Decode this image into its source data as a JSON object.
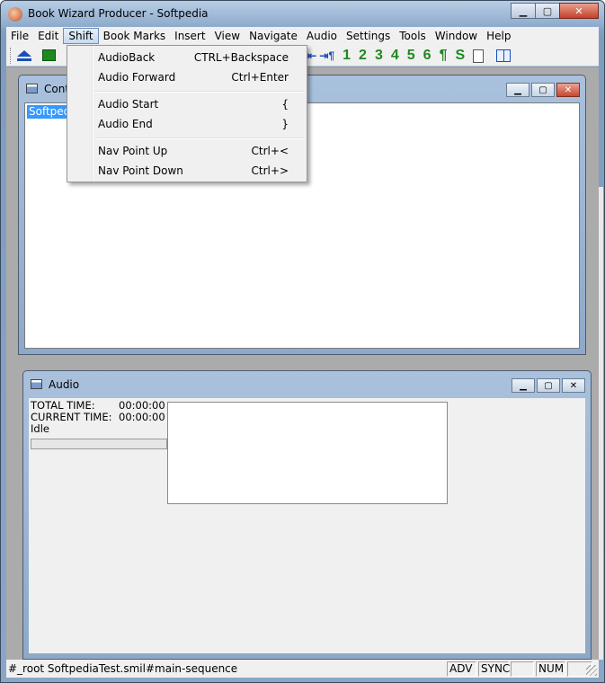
{
  "window": {
    "title": "Book Wizard Producer - Softpedia"
  },
  "menubar": {
    "items": [
      "File",
      "Edit",
      "Shift",
      "Book Marks",
      "Insert",
      "View",
      "Navigate",
      "Audio",
      "Settings",
      "Tools",
      "Window",
      "Help"
    ],
    "active": "Shift"
  },
  "toolbar": {
    "nav_glyph": "⇤ ⇥¶",
    "levels": [
      "1",
      "2",
      "3",
      "4",
      "5",
      "6"
    ],
    "para_glyph": "¶",
    "s_glyph": "S"
  },
  "shift_menu": {
    "groups": [
      [
        {
          "label": "AudioBack",
          "shortcut": "CTRL+Backspace"
        },
        {
          "label": "Audio Forward",
          "shortcut": "Ctrl+Enter"
        }
      ],
      [
        {
          "label": "Audio Start",
          "shortcut": "{"
        },
        {
          "label": "Audio End",
          "shortcut": "}"
        }
      ],
      [
        {
          "label": "Nav Point Up",
          "shortcut": "Ctrl+<"
        },
        {
          "label": "Nav Point Down",
          "shortcut": "Ctrl+>"
        }
      ]
    ]
  },
  "contents_window": {
    "title": "Cont",
    "selected_item": "Softpedia"
  },
  "audio_window": {
    "title": "Audio",
    "total_time_label": "TOTAL TIME:",
    "total_time_value": "00:00:00",
    "current_time_label": "CURRENT TIME:",
    "current_time_value": "00:00:00",
    "status": "Idle"
  },
  "statusbar": {
    "path": "#_root SoftpediaTest.smil#main-sequence",
    "panels": [
      "ADV",
      "SYNC",
      "",
      "NUM",
      ""
    ]
  },
  "colors": {
    "selection": "#3399ff",
    "toolbar_green": "#1d8a1d",
    "toolbar_blue": "#1a4fb8"
  }
}
